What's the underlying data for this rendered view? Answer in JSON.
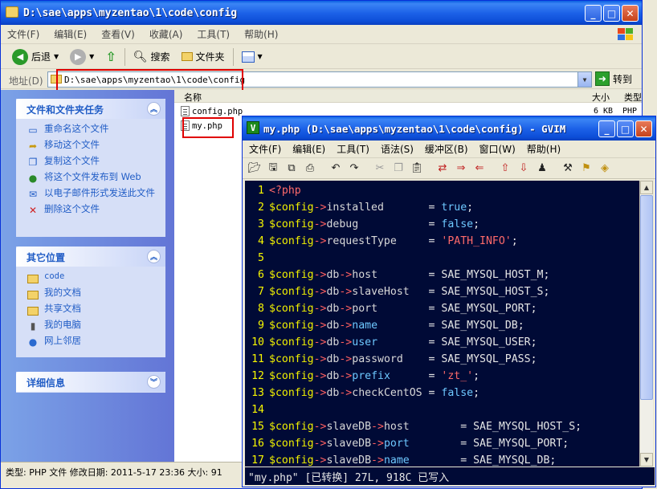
{
  "explorer": {
    "title": "D:\\sae\\apps\\myzentao\\1\\code\\config",
    "menu": [
      "文件(F)",
      "编辑(E)",
      "查看(V)",
      "收藏(A)",
      "工具(T)",
      "帮助(H)"
    ],
    "toolbar": {
      "back": "后退",
      "search": "搜索",
      "folders": "文件夹"
    },
    "address_label": "地址(D)",
    "address_value": "D:\\sae\\apps\\myzentao\\1\\code\\config",
    "go_label": "转到",
    "tasks_panel": {
      "title": "文件和文件夹任务",
      "items": [
        "重命名这个文件",
        "移动这个文件",
        "复制这个文件",
        "将这个文件发布到 Web",
        "以电子邮件形式发送此文件",
        "删除这个文件"
      ]
    },
    "places_panel": {
      "title": "其它位置",
      "items": [
        "code",
        "我的文档",
        "共享文档",
        "我的电脑",
        "网上邻居"
      ]
    },
    "details_panel": {
      "title": "详细信息"
    },
    "columns": {
      "name": "名称",
      "size": "大小",
      "type": "类型"
    },
    "files": [
      {
        "name": "config.php",
        "size": "6 KB",
        "type": "PHP"
      },
      {
        "name": "my.php",
        "size": "",
        "type": ""
      }
    ],
    "status_text": "类型: PHP 文件 修改日期: 2011-5-17 23:36 大小: 91"
  },
  "gvim": {
    "title": "my.php (D:\\sae\\apps\\myzentao\\1\\code\\config) - GVIM",
    "menu": [
      "文件(F)",
      "编辑(E)",
      "工具(T)",
      "语法(S)",
      "缓冲区(B)",
      "窗口(W)",
      "帮助(H)"
    ],
    "toolbar_icons": [
      "open-icon",
      "save-icon",
      "save-all-icon",
      "print-icon",
      "undo-icon",
      "redo-icon",
      "cut-icon",
      "copy-icon",
      "paste-icon",
      "replace-icon",
      "find-next-icon",
      "find-prev-icon",
      "load-session-icon",
      "save-session-icon",
      "run-script-icon",
      "make-icon",
      "run-ctags-icon",
      "tag-jump-icon"
    ],
    "lines": [
      {
        "n": "1",
        "parts": [
          [
            "tag",
            "<?php"
          ]
        ]
      },
      {
        "n": "2",
        "parts": [
          [
            "var",
            "$config"
          ],
          [
            "arrow",
            "->"
          ],
          [
            "prop",
            "installed       "
          ],
          [
            "op",
            "= "
          ],
          [
            "kw",
            "true"
          ],
          [
            "op",
            ";"
          ]
        ]
      },
      {
        "n": "3",
        "parts": [
          [
            "var",
            "$config"
          ],
          [
            "arrow",
            "->"
          ],
          [
            "prop",
            "debug           "
          ],
          [
            "op",
            "= "
          ],
          [
            "kw",
            "false"
          ],
          [
            "op",
            ";"
          ]
        ]
      },
      {
        "n": "4",
        "parts": [
          [
            "var",
            "$config"
          ],
          [
            "arrow",
            "->"
          ],
          [
            "prop",
            "requestType     "
          ],
          [
            "op",
            "= "
          ],
          [
            "str",
            "'PATH_INFO'"
          ],
          [
            "op",
            ";"
          ]
        ]
      },
      {
        "n": "5",
        "parts": []
      },
      {
        "n": "6",
        "parts": [
          [
            "var",
            "$config"
          ],
          [
            "arrow",
            "->"
          ],
          [
            "prop",
            "db"
          ],
          [
            "arrow",
            "->"
          ],
          [
            "prop",
            "host        "
          ],
          [
            "op",
            "= SAE_MYSQL_HOST_M;"
          ]
        ]
      },
      {
        "n": "7",
        "parts": [
          [
            "var",
            "$config"
          ],
          [
            "arrow",
            "->"
          ],
          [
            "prop",
            "db"
          ],
          [
            "arrow",
            "->"
          ],
          [
            "prop",
            "slaveHost   "
          ],
          [
            "op",
            "= SAE_MYSQL_HOST_S;"
          ]
        ]
      },
      {
        "n": "8",
        "parts": [
          [
            "var",
            "$config"
          ],
          [
            "arrow",
            "->"
          ],
          [
            "prop",
            "db"
          ],
          [
            "arrow",
            "->"
          ],
          [
            "prop",
            "port        "
          ],
          [
            "op",
            "= SAE_MYSQL_PORT;"
          ]
        ]
      },
      {
        "n": "9",
        "parts": [
          [
            "var",
            "$config"
          ],
          [
            "arrow",
            "->"
          ],
          [
            "prop",
            "db"
          ],
          [
            "arrow",
            "->"
          ],
          [
            "kw",
            "name"
          ],
          [
            "prop",
            "        "
          ],
          [
            "op",
            "= SAE_MYSQL_DB;"
          ]
        ]
      },
      {
        "n": "10",
        "parts": [
          [
            "var",
            "$config"
          ],
          [
            "arrow",
            "->"
          ],
          [
            "prop",
            "db"
          ],
          [
            "arrow",
            "->"
          ],
          [
            "kw",
            "user"
          ],
          [
            "prop",
            "        "
          ],
          [
            "op",
            "= SAE_MYSQL_USER;"
          ]
        ]
      },
      {
        "n": "11",
        "parts": [
          [
            "var",
            "$config"
          ],
          [
            "arrow",
            "->"
          ],
          [
            "prop",
            "db"
          ],
          [
            "arrow",
            "->"
          ],
          [
            "prop",
            "password    "
          ],
          [
            "op",
            "= SAE_MYSQL_PASS;"
          ]
        ]
      },
      {
        "n": "12",
        "parts": [
          [
            "var",
            "$config"
          ],
          [
            "arrow",
            "->"
          ],
          [
            "prop",
            "db"
          ],
          [
            "arrow",
            "->"
          ],
          [
            "kw",
            "prefix"
          ],
          [
            "prop",
            "      "
          ],
          [
            "op",
            "= "
          ],
          [
            "str",
            "'zt_'"
          ],
          [
            "op",
            ";"
          ]
        ]
      },
      {
        "n": "13",
        "parts": [
          [
            "var",
            "$config"
          ],
          [
            "arrow",
            "->"
          ],
          [
            "prop",
            "db"
          ],
          [
            "arrow",
            "->"
          ],
          [
            "prop",
            "checkCentOS "
          ],
          [
            "op",
            "= "
          ],
          [
            "kw",
            "false"
          ],
          [
            "op",
            ";"
          ]
        ]
      },
      {
        "n": "14",
        "parts": []
      },
      {
        "n": "15",
        "parts": [
          [
            "var",
            "$config"
          ],
          [
            "arrow",
            "->"
          ],
          [
            "prop",
            "slaveDB"
          ],
          [
            "arrow",
            "->"
          ],
          [
            "prop",
            "host        "
          ],
          [
            "op",
            "= SAE_MYSQL_HOST_S;"
          ]
        ]
      },
      {
        "n": "16",
        "parts": [
          [
            "var",
            "$config"
          ],
          [
            "arrow",
            "->"
          ],
          [
            "prop",
            "slaveDB"
          ],
          [
            "arrow",
            "->"
          ],
          [
            "kw",
            "port"
          ],
          [
            "prop",
            "        "
          ],
          [
            "op",
            "= SAE_MYSQL_PORT;"
          ]
        ]
      },
      {
        "n": "17",
        "parts": [
          [
            "var",
            "$config"
          ],
          [
            "arrow",
            "->"
          ],
          [
            "prop",
            "slaveDB"
          ],
          [
            "arrow",
            "->"
          ],
          [
            "kw",
            "name"
          ],
          [
            "prop",
            "        "
          ],
          [
            "op",
            "= SAE_MYSQL_DB;"
          ]
        ]
      }
    ],
    "cmdline": "\"my.php\" [已转换] 27L, 918C 已写入"
  },
  "colors": {
    "editor_bg": "#000a36",
    "line_number": "#f7f700",
    "highlight_box": "#e00000"
  }
}
